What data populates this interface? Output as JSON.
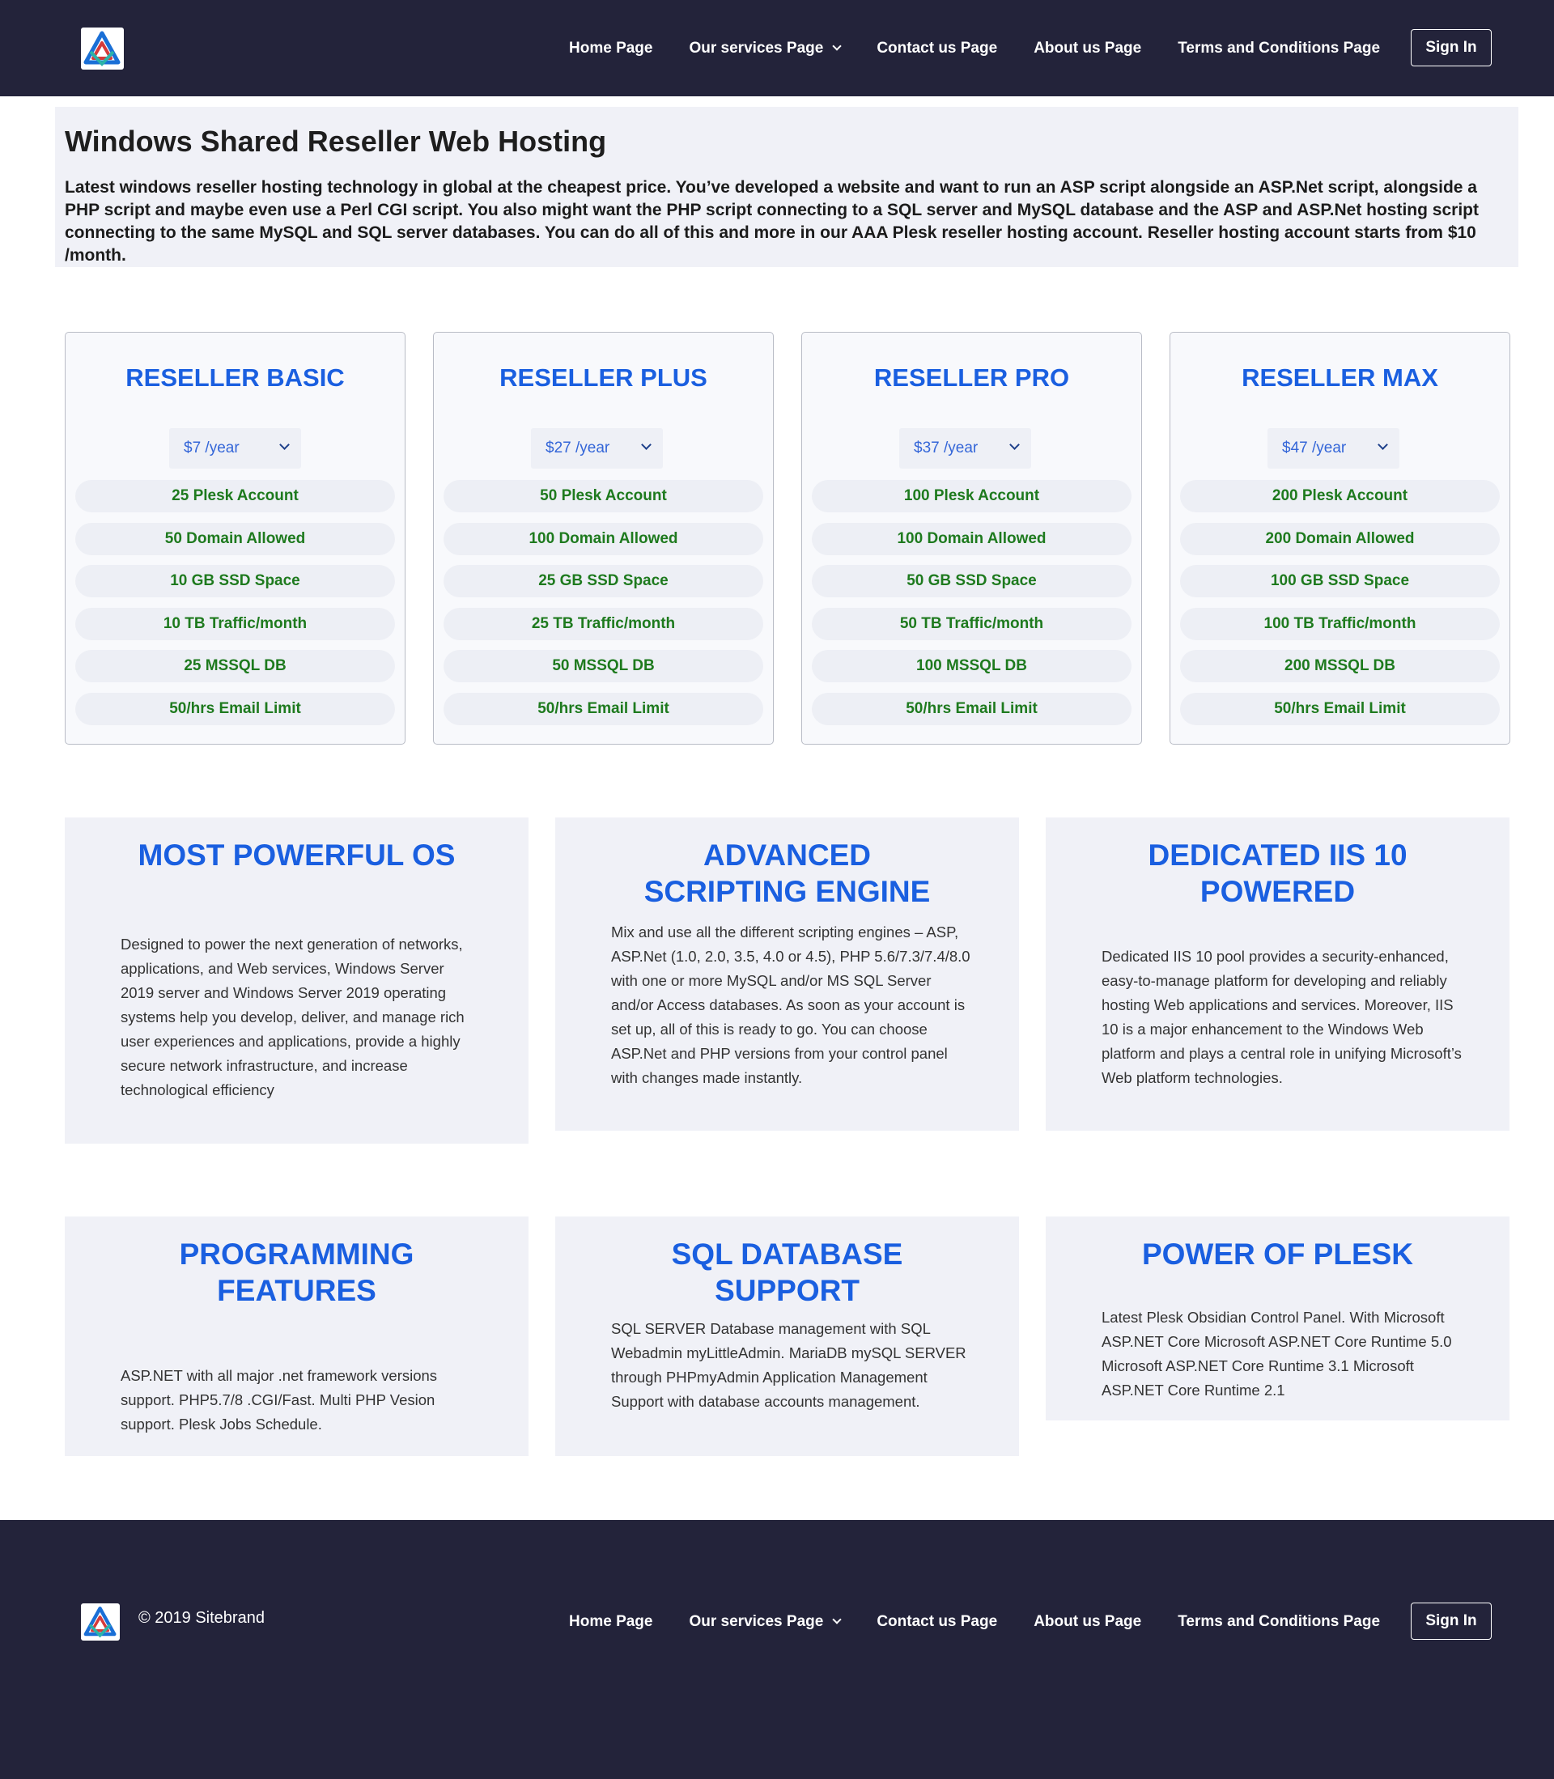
{
  "header": {
    "nav": [
      "Home Page",
      "Our services Page",
      "Contact us Page",
      "About us Page",
      "Terms and Conditions Page"
    ],
    "sign_in": "Sign In"
  },
  "intro": {
    "title": "Windows Shared Reseller Web Hosting",
    "text": "Latest windows reseller hosting technology in global at the cheapest price. You’ve developed a website and want to run an ASP script alongside an ASP.Net script, alongside a PHP script and maybe even use a Perl CGI script. You also might want the PHP script connecting to a SQL server and MySQL database and the ASP and ASP.Net hosting script connecting to the same MySQL and SQL server databases. You can do all of this and more in our AAA Plesk reseller hosting account. Reseller hosting account starts from $10 /month."
  },
  "plans": [
    {
      "title": "RESELLER BASIC",
      "price": "$7 /year",
      "features": [
        "25 Plesk Account",
        "50 Domain Allowed",
        "10 GB SSD Space",
        "10 TB Traffic/month",
        "25 MSSQL DB",
        "50/hrs Email Limit"
      ]
    },
    {
      "title": "RESELLER PLUS",
      "price": "$27 /year",
      "features": [
        "50 Plesk Account",
        "100 Domain Allowed",
        "25 GB SSD Space",
        "25 TB Traffic/month",
        "50 MSSQL DB",
        "50/hrs Email Limit"
      ]
    },
    {
      "title": "RESELLER PRO",
      "price": "$37 /year",
      "features": [
        "100 Plesk Account",
        "100 Domain Allowed",
        "50 GB SSD Space",
        "50 TB Traffic/month",
        "100 MSSQL DB",
        "50/hrs Email Limit"
      ]
    },
    {
      "title": "RESELLER MAX",
      "price": "$47 /year",
      "features": [
        "200 Plesk Account",
        "200 Domain Allowed",
        "100 GB SSD Space",
        "100 TB Traffic/month",
        "200 MSSQL DB",
        "50/hrs Email Limit"
      ]
    }
  ],
  "features": [
    {
      "title": "MOST POWERFUL OS",
      "text": "Designed to power the next generation of networks, applications, and Web services, Windows Server 2019 server and Windows Server 2019 operating systems help you develop, deliver, and manage rich user experiences and applications, provide a highly secure network infrastructure, and increase technological efficiency"
    },
    {
      "title": "ADVANCED SCRIPTING ENGINE",
      "text": "Mix and use all the different scripting engines – ASP, ASP.Net (1.0, 2.0, 3.5, 4.0 or 4.5), PHP 5.6/7.3/7.4/8.0 with one or more MySQL and/or MS SQL Server and/or Access databases. As soon as your account is set up, all of this is ready to go. You can choose ASP.Net and PHP versions from your control panel with changes made instantly."
    },
    {
      "title": "DEDICATED IIS 10 POWERED",
      "text": "Dedicated IIS 10 pool provides a security-enhanced, easy-to-manage platform for developing and reliably hosting Web applications and services. Moreover, IIS 10 is a major enhancement to the Windows Web platform and plays a central role in unifying Microsoft’s Web platform technologies."
    },
    {
      "title": "PROGRAMMING FEATURES",
      "text": "ASP.NET with all major .net framework versions support. PHP5.7/8 .CGI/Fast. Multi PHP Vesion support. Plesk Jobs Schedule."
    },
    {
      "title": "SQL DATABASE SUPPORT",
      "text": "SQL SERVER Database management with SQL Webadmin myLittleAdmin. MariaDB mySQL SERVER through PHPmyAdmin Application Management Support with database accounts management."
    },
    {
      "title": "POWER OF PLESK",
      "text": "Latest Plesk Obsidian Control Panel. With Microsoft ASP.NET Core Microsoft ASP.NET Core Runtime 5.0 Microsoft ASP.NET Core Runtime 3.1 Microsoft ASP.NET Core Runtime 2.1"
    }
  ],
  "footer": {
    "copyright": "© 2019 Sitebrand",
    "nav": [
      "Home Page",
      "Our services Page",
      "Contact us Page",
      "About us Page",
      "Terms and Conditions Page"
    ],
    "sign_in": "Sign In"
  },
  "icons": {
    "logo": "brand-logo-icon",
    "dropdown": "chevron-down-icon"
  },
  "colors": {
    "nav_bg": "#23233a",
    "accent": "#1a5fe0",
    "feature_text": "#1e7a1e",
    "panel_bg": "#f0f1f7"
  }
}
